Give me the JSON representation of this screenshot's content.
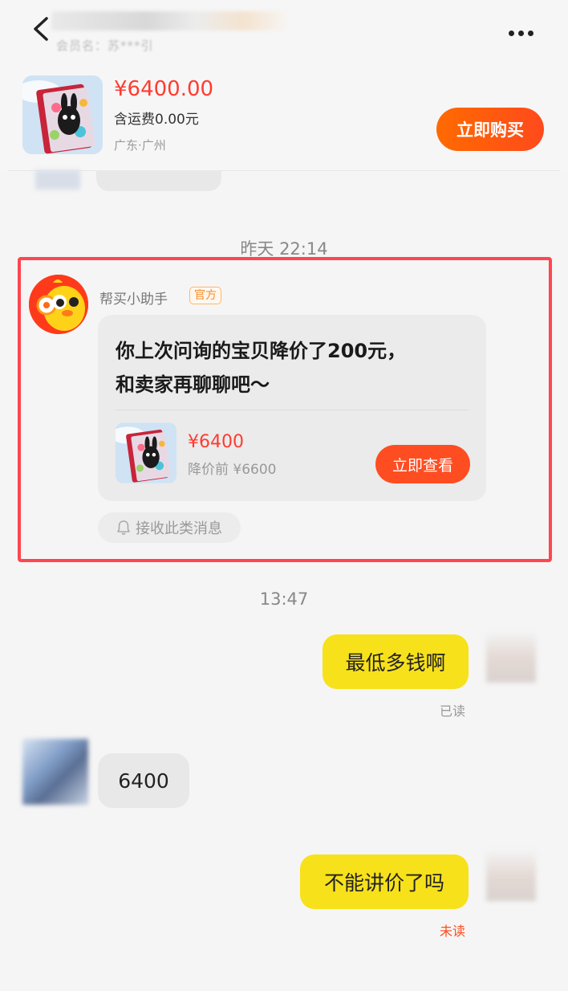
{
  "header": {
    "member_label": "会员名：苏***引",
    "price": "¥6400.00",
    "shipping": "含运费0.00元",
    "location": "广东·广州",
    "buy_button": "立即购买"
  },
  "timestamps": {
    "yesterday": "昨天 22:14",
    "today": "13:47"
  },
  "assistant_message": {
    "sender_name": "帮买小助手",
    "badge": "官方",
    "text_line1": "你上次问询的宝贝降价了200元，",
    "text_line2": "和卖家再聊聊吧～",
    "price": "¥6400",
    "original_price": "降价前 ¥6600",
    "view_button": "立即查看",
    "receive_button": "接收此类消息"
  },
  "messages": [
    {
      "side": "right",
      "text": "最低多钱啊",
      "status": "已读"
    },
    {
      "side": "left",
      "text": "6400"
    },
    {
      "side": "right",
      "text": "不能讲价了吗",
      "status": "未读"
    }
  ],
  "colors": {
    "accent_red": "#ff3b30",
    "buy_orange": "#ff5a14",
    "bubble_yellow": "#f7e11b",
    "highlight_border": "#ff4650",
    "unread_red": "#ff4a1c"
  }
}
